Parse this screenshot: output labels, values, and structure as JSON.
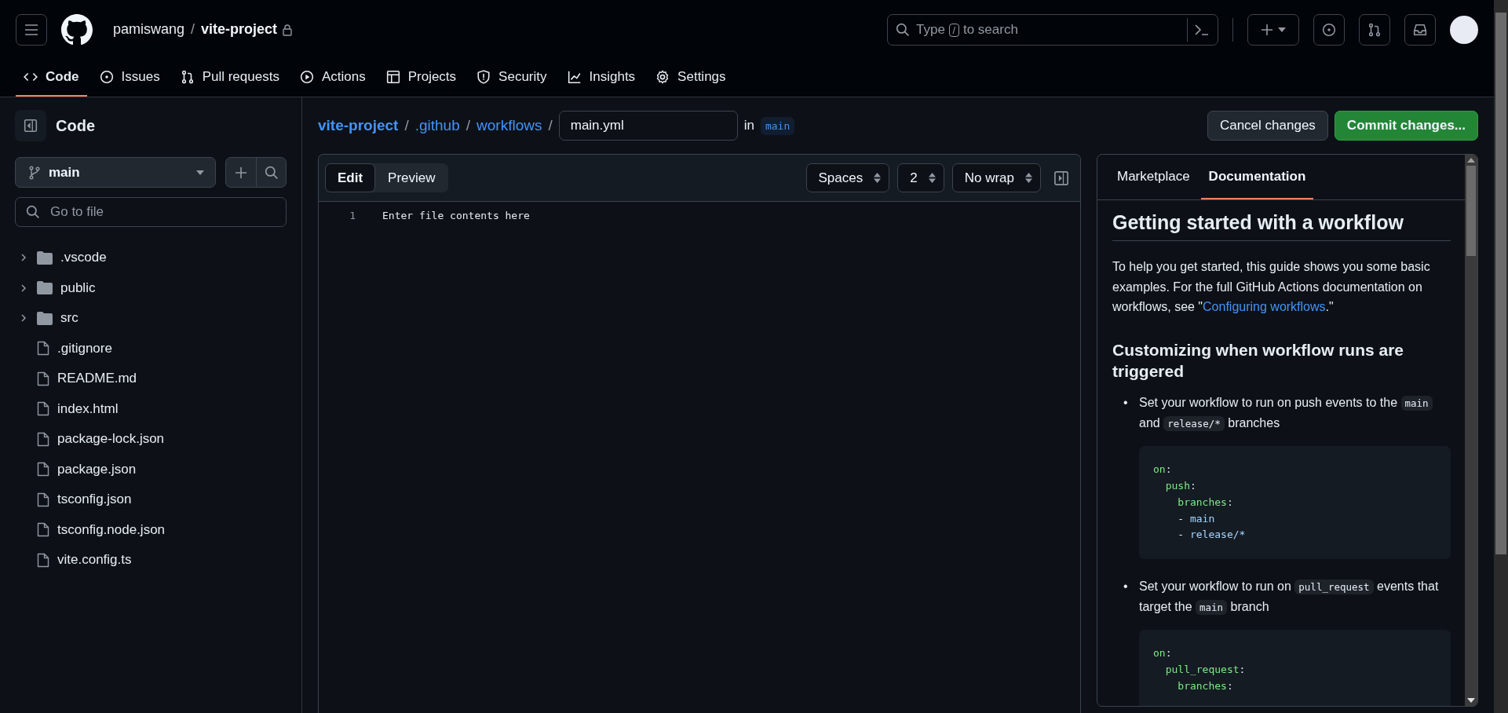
{
  "header": {
    "owner": "pamiswang",
    "separator": "/",
    "repo": "vite-project",
    "private": true,
    "search_placeholder_before": "Type",
    "search_key": "/",
    "search_placeholder_after": "to search"
  },
  "nav": [
    {
      "label": "Code",
      "selected": true
    },
    {
      "label": "Issues",
      "selected": false
    },
    {
      "label": "Pull requests",
      "selected": false
    },
    {
      "label": "Actions",
      "selected": false
    },
    {
      "label": "Projects",
      "selected": false
    },
    {
      "label": "Security",
      "selected": false
    },
    {
      "label": "Insights",
      "selected": false
    },
    {
      "label": "Settings",
      "selected": false
    }
  ],
  "sidebar": {
    "title": "Code",
    "branch": "main",
    "filter_placeholder": "Go to file",
    "items": [
      {
        "kind": "folder",
        "name": ".vscode",
        "expanded": false
      },
      {
        "kind": "folder",
        "name": "public",
        "expanded": false
      },
      {
        "kind": "folder",
        "name": "src",
        "expanded": false
      },
      {
        "kind": "file",
        "name": ".gitignore"
      },
      {
        "kind": "file",
        "name": "README.md"
      },
      {
        "kind": "file",
        "name": "index.html"
      },
      {
        "kind": "file",
        "name": "package-lock.json"
      },
      {
        "kind": "file",
        "name": "package.json"
      },
      {
        "kind": "file",
        "name": "tsconfig.json"
      },
      {
        "kind": "file",
        "name": "tsconfig.node.json"
      },
      {
        "kind": "file",
        "name": "vite.config.ts"
      }
    ]
  },
  "breadcrumb": {
    "parts": [
      {
        "text": "vite-project",
        "bold": true
      },
      {
        "text": ".github",
        "bold": false
      },
      {
        "text": "workflows",
        "bold": false
      }
    ],
    "separator": "/",
    "filename": "main.yml",
    "in_label": "in",
    "branch": "main"
  },
  "actions": {
    "cancel": "Cancel changes",
    "commit": "Commit changes..."
  },
  "editor": {
    "tabs": [
      {
        "label": "Edit",
        "selected": true
      },
      {
        "label": "Preview",
        "selected": false
      }
    ],
    "selects": [
      "Spaces",
      "2",
      "No wrap"
    ],
    "lines": [
      {
        "number": "1",
        "placeholder": "Enter file contents here"
      }
    ]
  },
  "docs": {
    "tabs": [
      {
        "label": "Marketplace",
        "selected": false
      },
      {
        "label": "Documentation",
        "selected": true
      }
    ],
    "blocks": [
      {
        "kind": "h1",
        "segments": [
          {
            "kind": "text",
            "text": "Getting started with a workflow"
          }
        ]
      },
      {
        "kind": "p",
        "segments": [
          {
            "kind": "text",
            "text": "To help you get started, this guide shows you some basic examples. For the full GitHub Actions documentation on workflows, see \""
          },
          {
            "kind": "link",
            "text": "Configuring workflows"
          },
          {
            "kind": "text",
            "text": ".\""
          }
        ]
      },
      {
        "kind": "h2",
        "segments": [
          {
            "kind": "text",
            "text": "Customizing when workflow runs are triggered"
          }
        ]
      },
      {
        "kind": "li",
        "bullet": "•",
        "segments": [
          {
            "kind": "text",
            "text": "Set your workflow to run on push events to the "
          },
          {
            "kind": "code",
            "text": "main"
          },
          {
            "kind": "text",
            "text": " and "
          },
          {
            "kind": "code",
            "text": "release/*"
          },
          {
            "kind": "text",
            "text": " branches"
          }
        ]
      },
      {
        "kind": "pre",
        "lines": [
          [
            {
              "kind": "key",
              "text": "on"
            },
            {
              "kind": "punct",
              "text": ":"
            }
          ],
          [
            {
              "kind": "key",
              "text": "  push"
            },
            {
              "kind": "punct",
              "text": ":"
            }
          ],
          [
            {
              "kind": "key",
              "text": "    branches"
            },
            {
              "kind": "punct",
              "text": ":"
            }
          ],
          [
            {
              "kind": "punct",
              "text": "    - "
            },
            {
              "kind": "value",
              "text": "main"
            }
          ],
          [
            {
              "kind": "punct",
              "text": "    - "
            },
            {
              "kind": "value",
              "text": "release/*"
            }
          ]
        ]
      },
      {
        "kind": "li",
        "bullet": "•",
        "segments": [
          {
            "kind": "text",
            "text": "Set your workflow to run on "
          },
          {
            "kind": "code",
            "text": "pull_request"
          },
          {
            "kind": "text",
            "text": " events that target the "
          },
          {
            "kind": "code",
            "text": "main"
          },
          {
            "kind": "text",
            "text": " branch"
          }
        ]
      },
      {
        "kind": "pre",
        "lines": [
          [
            {
              "kind": "key",
              "text": "on"
            },
            {
              "kind": "punct",
              "text": ":"
            }
          ],
          [
            {
              "kind": "key",
              "text": "  pull_request"
            },
            {
              "kind": "punct",
              "text": ":"
            }
          ],
          [
            {
              "kind": "key",
              "text": "    branches"
            },
            {
              "kind": "punct",
              "text": ":"
            }
          ]
        ]
      }
    ]
  }
}
